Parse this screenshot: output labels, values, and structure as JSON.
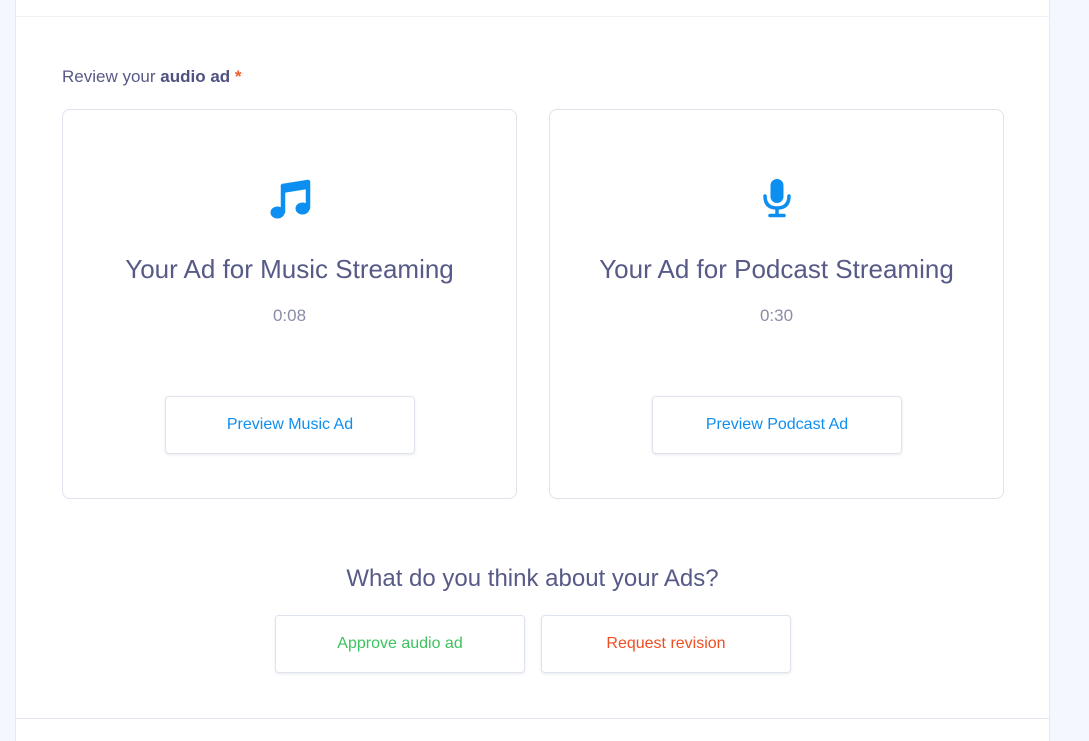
{
  "review": {
    "label_prefix": "Review your ",
    "label_bold": "audio ad",
    "required_mark": "*"
  },
  "cards": {
    "music": {
      "icon": "music-note-icon",
      "title": "Your Ad for Music Streaming",
      "duration": "0:08",
      "button_label": "Preview Music Ad"
    },
    "podcast": {
      "icon": "microphone-icon",
      "title": "Your Ad for Podcast Streaming",
      "duration": "0:30",
      "button_label": "Preview Podcast Ad"
    }
  },
  "feedback": {
    "question": "What do you think about your Ads?",
    "approve_label": "Approve audio ad",
    "revise_label": "Request revision"
  },
  "colors": {
    "icon_blue": "#0d8ff2",
    "text_primary": "#575a87",
    "approve_green": "#3cc35f",
    "revise_red": "#ef4e23",
    "required_orange": "#f05a28"
  }
}
